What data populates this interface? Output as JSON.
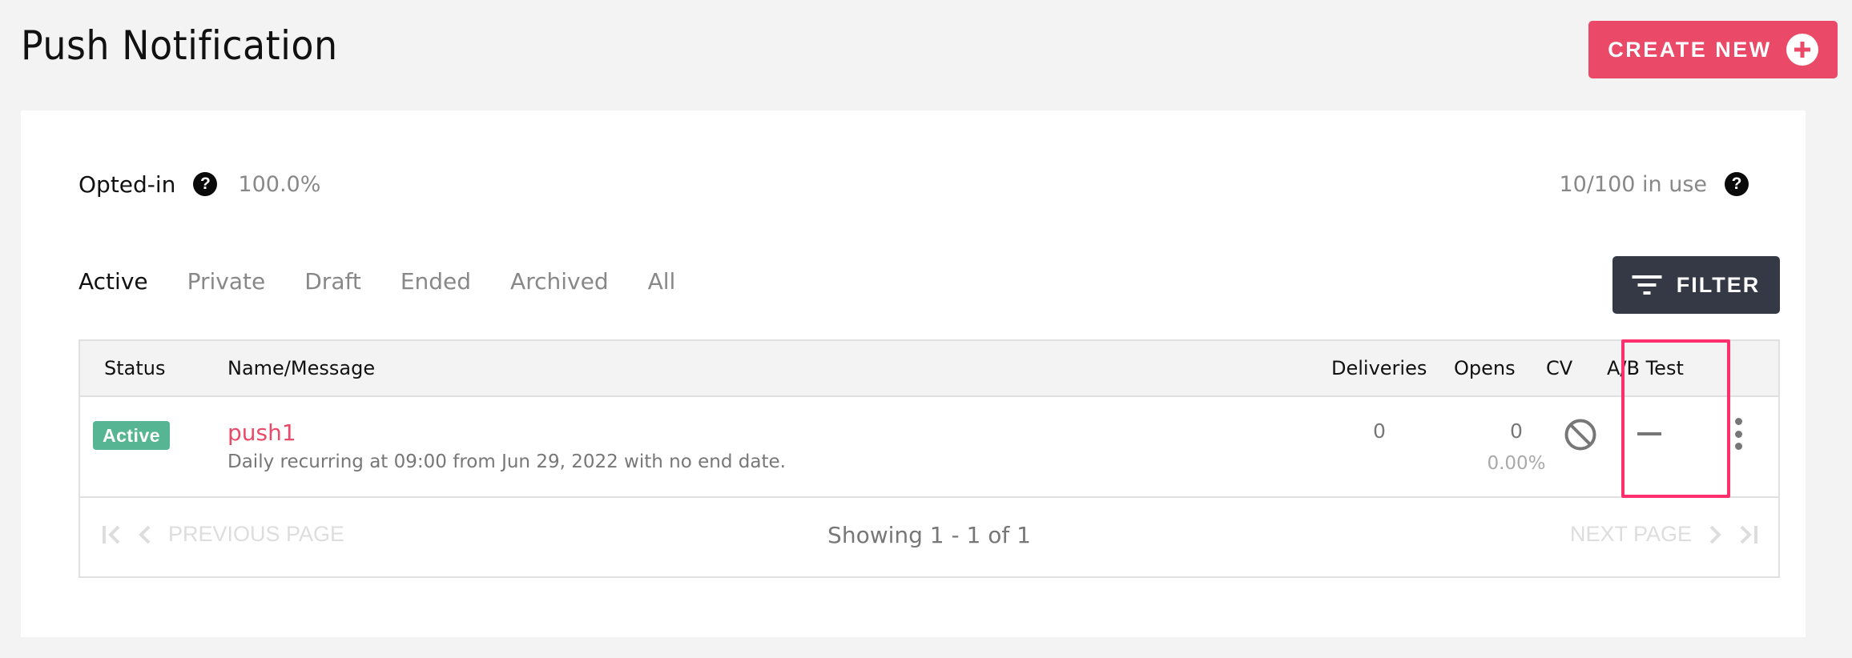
{
  "header": {
    "title": "Push Notification",
    "create_label": "CREATE NEW",
    "create_icon": "plus-circle-icon"
  },
  "summary": {
    "opted_in_label": "Opted-in",
    "opted_in_value": "100.0%",
    "quota_value": "10/100 in use",
    "help_glyph": "?"
  },
  "tabs": [
    {
      "label": "Active",
      "active": true
    },
    {
      "label": "Private",
      "active": false
    },
    {
      "label": "Draft",
      "active": false
    },
    {
      "label": "Ended",
      "active": false
    },
    {
      "label": "Archived",
      "active": false
    },
    {
      "label": "All",
      "active": false
    }
  ],
  "filter": {
    "label": "FILTER",
    "icon": "filter-icon"
  },
  "table": {
    "columns": [
      "Status",
      "Name/Message",
      "Deliveries",
      "Opens",
      "CV",
      "A/B Test"
    ],
    "rows": [
      {
        "status": "Active",
        "name": "push1",
        "message": "Daily recurring at 09:00 from Jun 29, 2022 with no end date.",
        "deliveries": "0",
        "opens": "0",
        "open_rate": "0.00%",
        "cv": "not-available-icon",
        "ab_test": "—"
      }
    ]
  },
  "pagination": {
    "previous_label": "PREVIOUS PAGE",
    "next_label": "NEXT PAGE",
    "status": "Showing 1 - 1 of 1"
  },
  "colors": {
    "accent": "#ea4a68",
    "filter_bg": "#353946",
    "active_badge": "#56b592",
    "highlight": "#ff2f6e"
  }
}
